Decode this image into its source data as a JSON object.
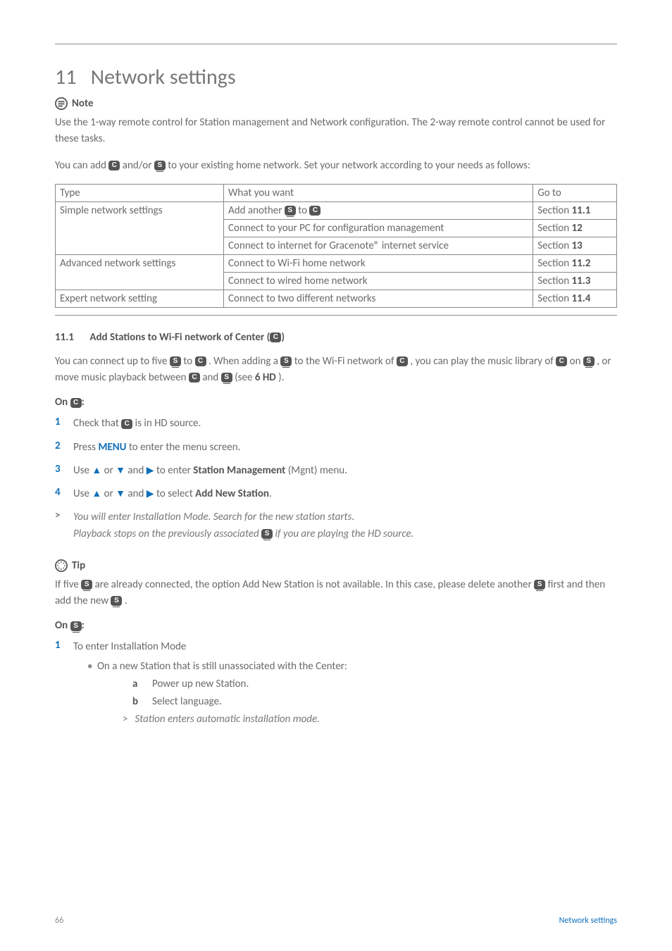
{
  "chapter": {
    "number": "11",
    "title": "Network settings"
  },
  "note": {
    "label": "Note",
    "text_a": "Use the 1-way remote control for Station management and Network configuration. The 2-way remote control cannot be used for these tasks.",
    "text_b_pre": "You can add ",
    "text_b_mid": " and/or ",
    "text_b_post": " to your existing home network. Set your network according to your needs as follows:"
  },
  "badges": {
    "c": "C",
    "s": "S"
  },
  "table": {
    "head": {
      "type": "Type",
      "what": "What you want",
      "goto": "Go to"
    },
    "rows": [
      {
        "type": "Simple network settings",
        "rowspan": 3,
        "what_pre": "Add another ",
        "what_post": " to ",
        "goto": "Section",
        "goto_b": "11.1"
      },
      {
        "what": "Connect to your PC for configuration management",
        "goto": "Section",
        "goto_b": "12"
      },
      {
        "what": "Connect to internet for Gracenote® internet service",
        "goto": "Section",
        "goto_b": "13"
      },
      {
        "type": "Advanced network settings",
        "rowspan": 2,
        "what": "Connect to Wi-Fi home network",
        "goto": "Section",
        "goto_b": "11.2"
      },
      {
        "what": "Connect to wired home network",
        "goto": "Section",
        "goto_b": "11.3"
      },
      {
        "type": "Expert network setting",
        "rowspan": 1,
        "what": "Connect to two different networks",
        "goto": "Section",
        "goto_b": "11.4"
      }
    ]
  },
  "section11_1": {
    "num": "11.1",
    "title_pre": "Add Stations to Wi-Fi network of Center (",
    "title_post": ")",
    "p1_a": "You can connect up to five ",
    "p1_b": " to ",
    "p1_c": ". When adding a ",
    "p1_d": " to the Wi-Fi network of ",
    "p1_e": ", you can play the music library of ",
    "p1_f": " on ",
    "p1_g": ", or move music playback between ",
    "p1_h": " and ",
    "p1_i": " (see ",
    "p1_j": "6 HD",
    "p1_k": ")."
  },
  "on_c": {
    "label_pre": "On ",
    "label_post": ":",
    "steps": {
      "s1_pre": "Check that ",
      "s1_post": " is in HD source.",
      "s2_pre": "Press ",
      "s2_kw": "MENU",
      "s2_post": " to enter the menu screen.",
      "s3_pre": "Use ",
      "s3_mid1": " or ",
      "s3_mid2": " and ",
      "s3_mid3": " to enter ",
      "s3_kw": "Station Management",
      "s3_post": " (Mgnt) menu.",
      "s4_pre": "Use ",
      "s4_mid1": " or ",
      "s4_mid2": " and ",
      "s4_mid3": " to select ",
      "s4_kw": "Add New Station",
      "s4_post": ".",
      "gt1": "You will enter Installation Mode. Search for the new station starts.",
      "gt2_pre": "Playback stops on the previously associated ",
      "gt2_post": " if you are playing the HD source."
    }
  },
  "tip": {
    "label": "Tip",
    "t1_pre": "If five ",
    "t1_mid": " are already connected, the option Add New Station is not available. In this case, please delete another ",
    "t1_mid2": " first and then add the new ",
    "t1_post": "."
  },
  "on_s": {
    "label_pre": "On ",
    "label_post": ":",
    "step1": "To enter Installation Mode",
    "bullet1": "On a new Station that is still unassociated with the Center:",
    "la": "Power up new Station.",
    "lb": "Select language.",
    "gt": "Station enters automatic installation mode."
  },
  "footer": {
    "page": "66",
    "section": "Network settings"
  }
}
